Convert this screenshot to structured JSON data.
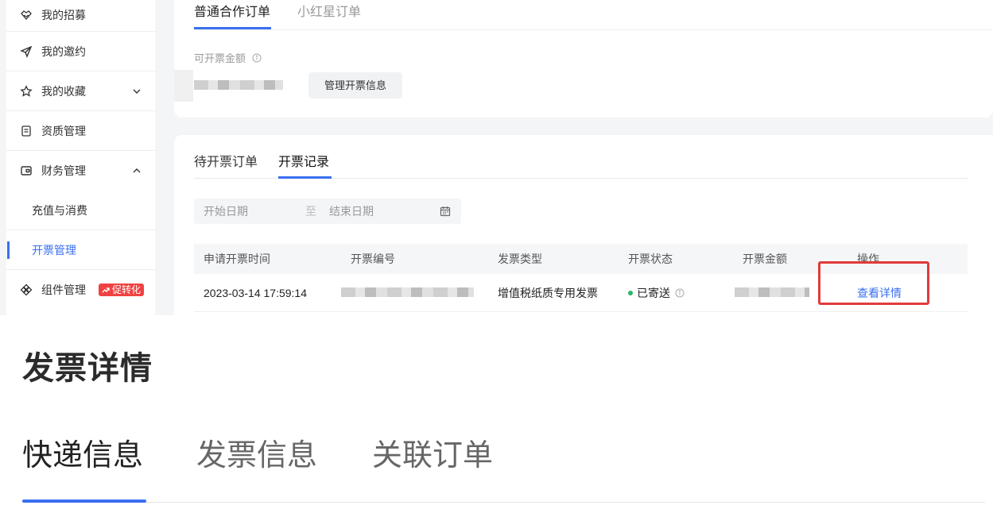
{
  "sidebar": {
    "items": [
      {
        "label": "我的招募",
        "icon": "handshake-icon"
      },
      {
        "label": "我的邀约",
        "icon": "send-icon"
      },
      {
        "label": "我的收藏",
        "icon": "star-icon",
        "expand": "chevron-down-icon"
      },
      {
        "label": "资质管理",
        "icon": "document-icon"
      },
      {
        "label": "财务管理",
        "icon": "wallet-icon",
        "expand": "chevron-up-icon"
      },
      {
        "label": "充值与消费"
      },
      {
        "label": "开票管理",
        "active": true
      },
      {
        "label": "组件管理",
        "icon": "component-icon",
        "badge": "促转化"
      }
    ]
  },
  "order_tabs": {
    "items": [
      "普通合作订单",
      "小红星订单"
    ],
    "active": 0
  },
  "invoice_amount": {
    "label": "可开票金额",
    "value": "",
    "manage_button": "管理开票信息"
  },
  "record_tabs": {
    "items": [
      "待开票订单",
      "开票记录"
    ],
    "active": 1
  },
  "date_filter": {
    "start_placeholder": "开始日期",
    "separator": "至",
    "end_placeholder": "结束日期"
  },
  "table": {
    "columns": [
      "申请开票时间",
      "开票编号",
      "发票类型",
      "开票状态",
      "开票金额",
      "操作"
    ],
    "rows": [
      {
        "apply_time": "2023-03-14 17:59:14",
        "invoice_no": "",
        "invoice_type": "增值税纸质专用发票",
        "status": "已寄送",
        "amount": "",
        "action": "查看详情"
      }
    ]
  },
  "detail": {
    "title": "发票详情",
    "tabs": [
      "快递信息",
      "发票信息",
      "关联订单"
    ],
    "active_tab": 0
  },
  "colors": {
    "accent": "#3a6ff0",
    "badge_red": "#f04242",
    "status_green": "#25b864",
    "highlight_red": "#e23a3a"
  }
}
